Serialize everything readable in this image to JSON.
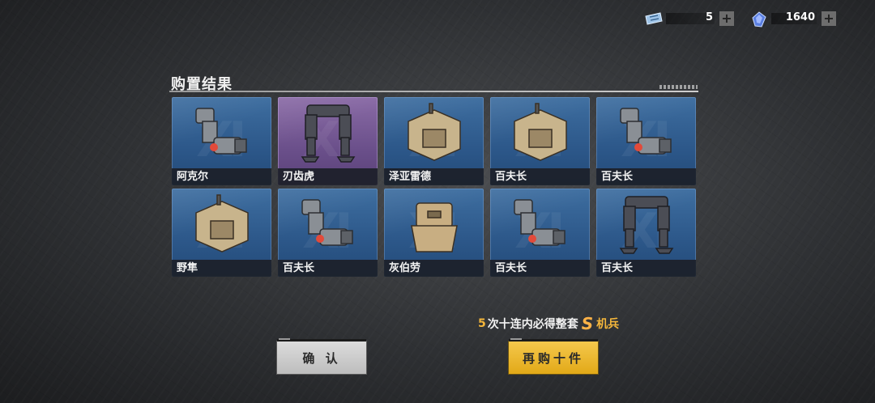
{
  "currency": {
    "tickets": {
      "icon": "ticket-icon",
      "value": "5"
    },
    "crystals": {
      "icon": "crystal-icon",
      "value": "1640"
    }
  },
  "title": "购置结果",
  "items": [
    {
      "name": "阿克尔",
      "rarity": "blue",
      "part": "arm"
    },
    {
      "name": "刃齿虎",
      "rarity": "purple",
      "part": "legs"
    },
    {
      "name": "泽亚雷德",
      "rarity": "blue",
      "part": "torso"
    },
    {
      "name": "百夫长",
      "rarity": "blue",
      "part": "torso"
    },
    {
      "name": "百夫长",
      "rarity": "blue",
      "part": "arm"
    },
    {
      "name": "野隼",
      "rarity": "blue",
      "part": "torso"
    },
    {
      "name": "百夫长",
      "rarity": "blue",
      "part": "arm"
    },
    {
      "name": "灰伯劳",
      "rarity": "blue",
      "part": "head"
    },
    {
      "name": "百夫长",
      "rarity": "blue",
      "part": "arm"
    },
    {
      "name": "百夫长",
      "rarity": "blue",
      "part": "legs"
    }
  ],
  "promo": {
    "count": "5",
    "mid": "次十连内必得整套",
    "badge": "S",
    "tail": "机兵"
  },
  "buttons": {
    "confirm": "确 认",
    "buy_again": "再购十件"
  },
  "colors": {
    "gold": "#f4b63b",
    "blue_card": "#2c5789",
    "purple_card": "#6a4f8a"
  }
}
